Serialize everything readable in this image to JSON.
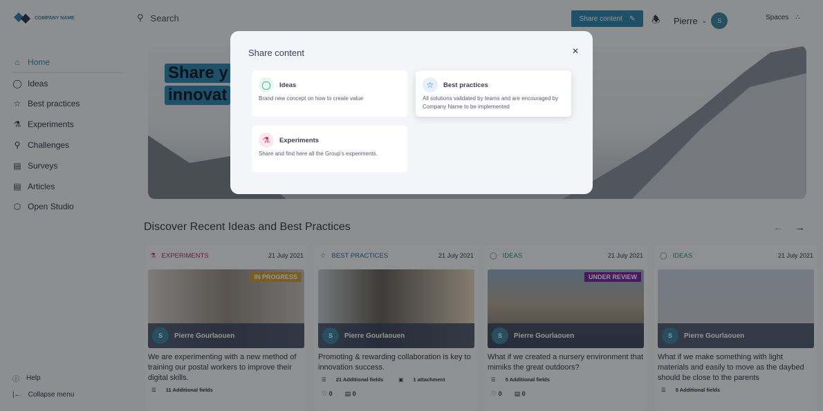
{
  "header": {
    "logo_text": "COMPANY NAME",
    "search_placeholder": "Search",
    "share_button": "Share content",
    "user_name": "Pierre",
    "spaces_label": "Spaces"
  },
  "sidebar": {
    "items": [
      {
        "label": "Home",
        "icon": "home-icon",
        "active": true
      },
      {
        "label": "Ideas",
        "icon": "lightbulb-icon"
      },
      {
        "label": "Best practices",
        "icon": "star-icon"
      },
      {
        "label": "Experiments",
        "icon": "flask-icon"
      },
      {
        "label": "Challenges",
        "icon": "trophy-icon"
      },
      {
        "label": "Surveys",
        "icon": "bar-chart-icon"
      },
      {
        "label": "Articles",
        "icon": "article-icon"
      },
      {
        "label": "Open Studio",
        "icon": "box-icon"
      }
    ],
    "help": "Help",
    "collapse": "Collapse menu"
  },
  "hero": {
    "line1": "Share y",
    "line2": "innovat"
  },
  "section": {
    "title": "Discover Recent Ideas and Best Practices"
  },
  "cards": [
    {
      "category": "EXPERIMENTS",
      "date": "21 July 2021",
      "badge": "IN PROGRESS",
      "author": "Pierre Gourlaouen",
      "description": "We are experimenting with a new method of training our postal workers to improve their digital skills.",
      "fields": "11 Additional fields",
      "color": "#c0325c"
    },
    {
      "category": "BEST PRACTICES",
      "date": "21 July 2021",
      "author": "Pierre Gourlaouen",
      "description": "Promoting & rewarding collaboration is key to innovation success.",
      "fields": "21 Additional fields",
      "attachments": "1 attachment",
      "likes": "0",
      "comments": "0",
      "color": "#1f6fb0"
    },
    {
      "category": "IDEAS",
      "date": "21 July 2021",
      "badge": "UNDER REVIEW",
      "author": "Pierre Gourlaouen",
      "description": "What if we created a nursery environment that mimiks the great outdoors?",
      "fields": "5 Additional fields",
      "likes": "0",
      "comments": "0",
      "color": "#1a9b77"
    },
    {
      "category": "IDEAS",
      "date": "21 July 2021",
      "author": "Pierre Gourlaouen",
      "description": "What if we make something with light materials and easily to move as the daybed should be close to the parents",
      "fields": "5 Additional fields",
      "color": "#1a9b77"
    }
  ],
  "modal": {
    "title": "Share content",
    "options": [
      {
        "title": "Ideas",
        "description": "Brand new concept on how to create value",
        "icon": "lightbulb-icon"
      },
      {
        "title": "Best practices",
        "description": "All solutions validated by teams and are encouraged by Company Name to be implemented",
        "icon": "star-icon"
      },
      {
        "title": "Experiments",
        "description": "Share and find here all the Group's experiments.",
        "icon": "flask-icon"
      }
    ]
  },
  "colors": {
    "accent": "#1f8fc9",
    "in_progress": "#e0a21a",
    "under_review": "#8a22c9"
  }
}
